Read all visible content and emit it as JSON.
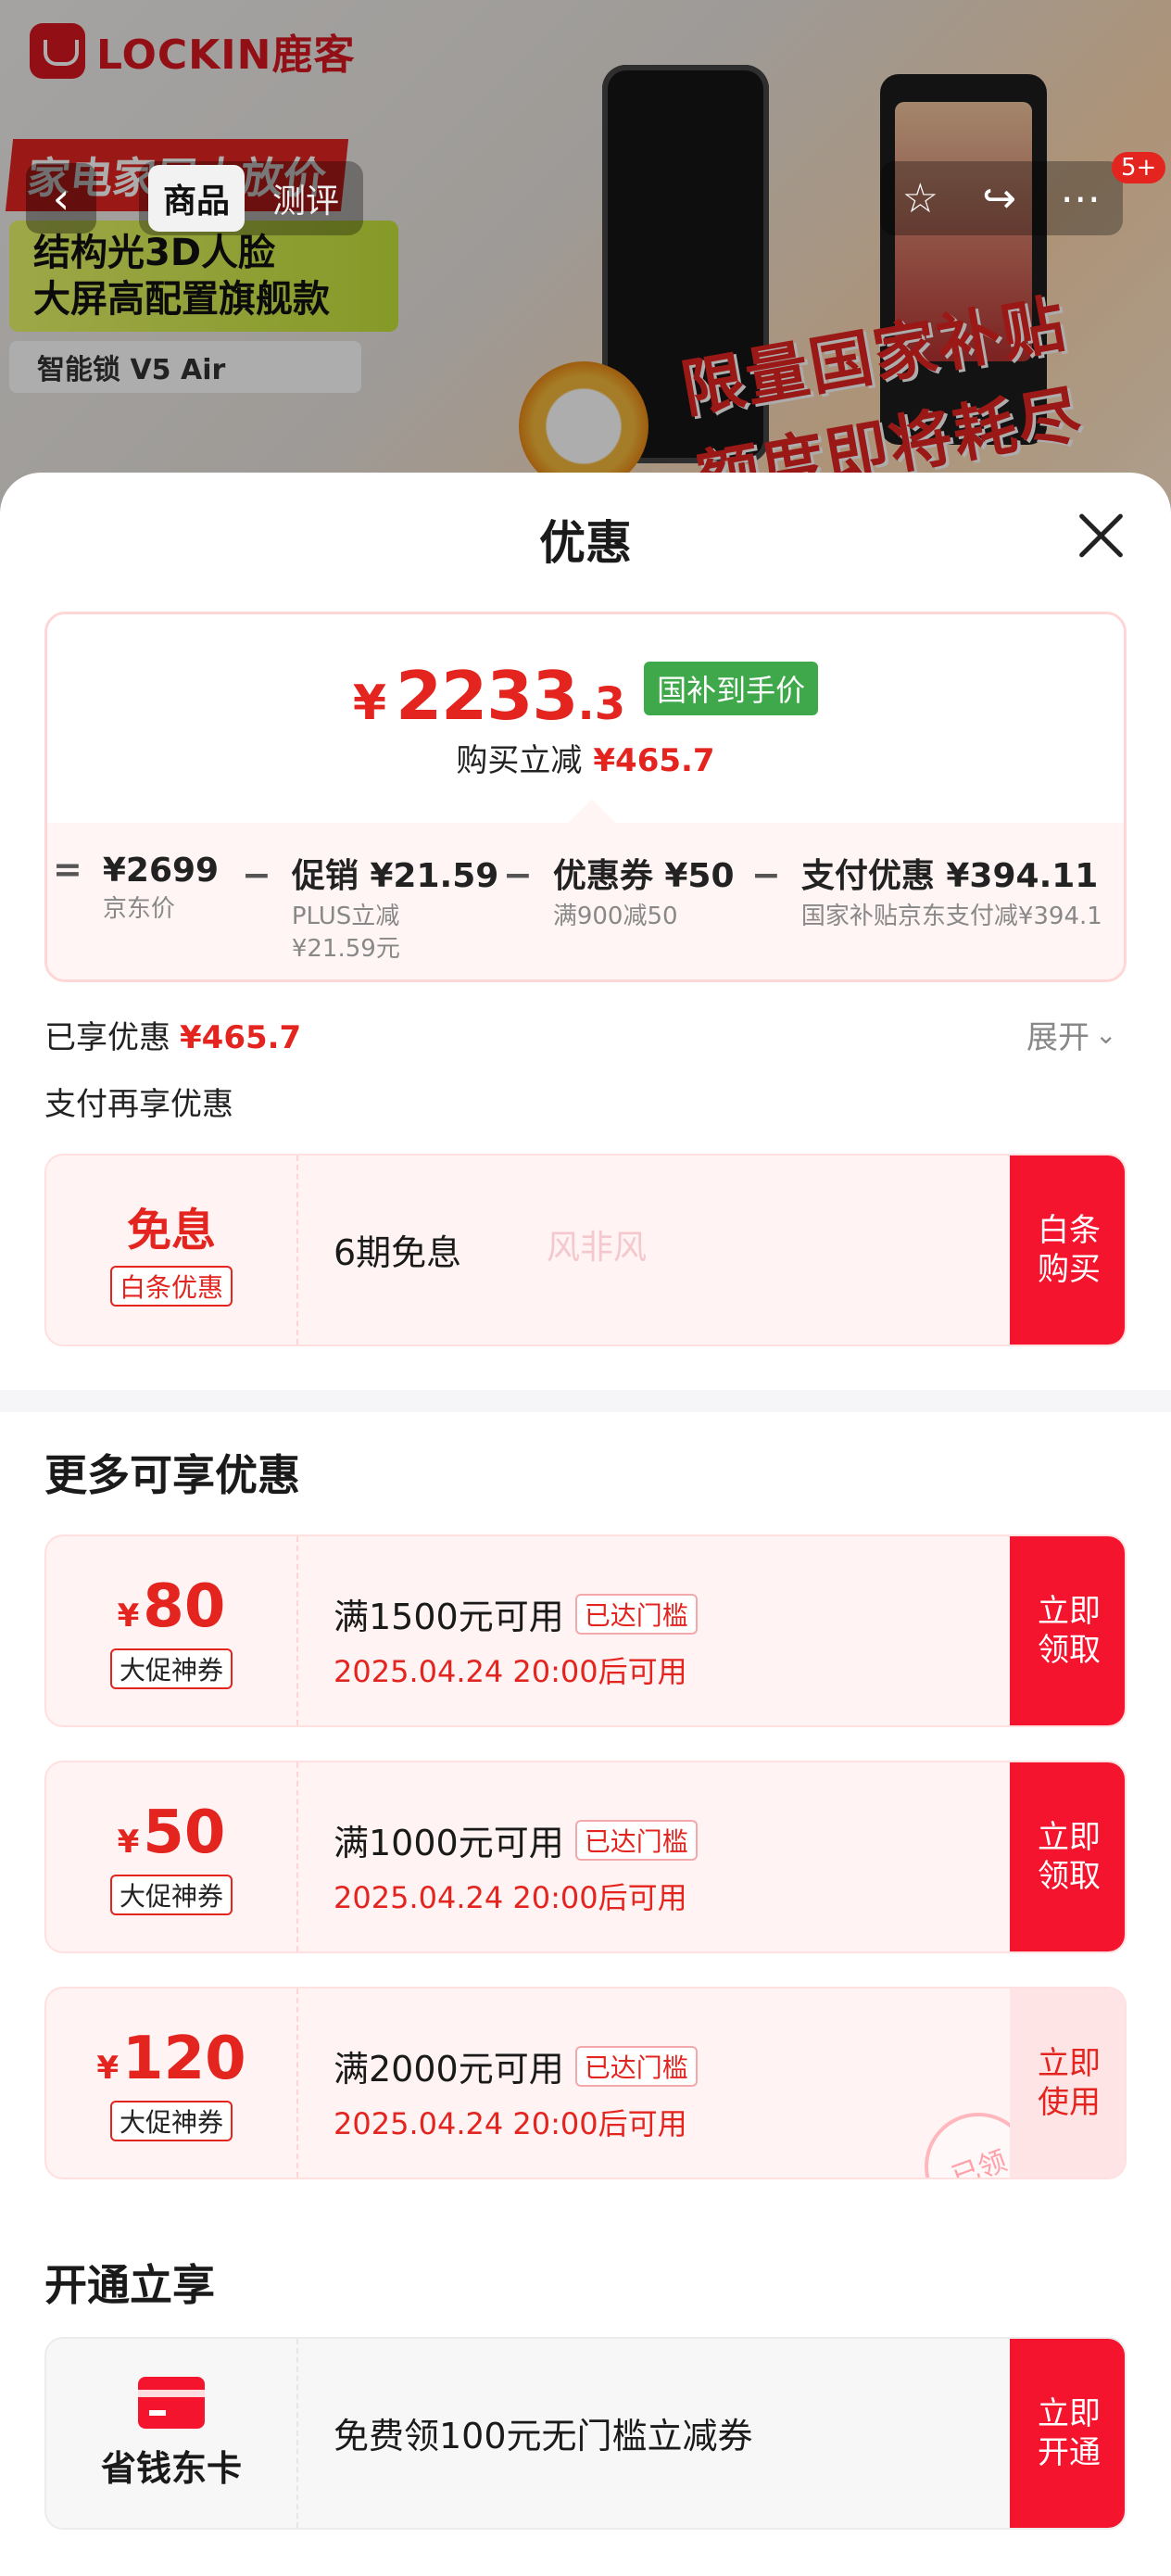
{
  "banner": {
    "brand": "LOCKIN鹿客",
    "promo_left": {
      "line1": "家电家居大放价",
      "line2a": "结构光3D人脸",
      "line2b": "大屏高配置旗舰款",
      "line3": "智能锁 V5 Air"
    },
    "promo_right": {
      "line1": "限量国家补贴",
      "line2": "额度即将耗尽"
    }
  },
  "nav": {
    "tabs": [
      {
        "label": "商品",
        "active": true
      },
      {
        "label": "测评",
        "active": false
      }
    ],
    "cart_badge": "5+"
  },
  "sheet": {
    "title": "优惠",
    "price": {
      "currency": "¥",
      "integer": "2233",
      "decimal": ".3",
      "tag": "国补到手价",
      "reduce_label": "购买立减",
      "reduce_amount": "¥465.7"
    },
    "breakdown": [
      {
        "op": "=",
        "value": "¥2699",
        "label": "京东价",
        "label2": ""
      },
      {
        "op": "−",
        "value": "促销 ¥21.59",
        "label": "PLUS立减",
        "label2": "¥21.59元"
      },
      {
        "op": "−",
        "value": "优惠券 ¥50",
        "label": "满900减50",
        "label2": ""
      },
      {
        "op": "−",
        "value": "支付优惠 ¥394.11",
        "label": "国家补贴京东支付减¥394.1",
        "label2": ""
      }
    ],
    "enjoyed_label": "已享优惠",
    "enjoyed_amount": "¥465.7",
    "expand_label": "展开",
    "pay_more_label": "支付再享优惠",
    "baitiao": {
      "big": "免息",
      "chip": "白条优惠",
      "text": "6期免息",
      "watermark": "风非风",
      "action": "白条购买"
    },
    "more_title": "更多可享优惠",
    "coupons": [
      {
        "yen": "¥",
        "amount": "80",
        "chip": "大促神券",
        "condition": "满1500元可用",
        "reached": "已达门槛",
        "time": "2025.04.24 20:00后可用",
        "action": "立即领取",
        "claimed": false
      },
      {
        "yen": "¥",
        "amount": "50",
        "chip": "大促神券",
        "condition": "满1000元可用",
        "reached": "已达门槛",
        "time": "2025.04.24 20:00后可用",
        "action": "立即领取",
        "claimed": false
      },
      {
        "yen": "¥",
        "amount": "120",
        "chip": "大促神券",
        "condition": "满2000元可用",
        "reached": "已达门槛",
        "time": "2025.04.24 20:00后可用",
        "action": "立即使用",
        "claimed": true,
        "stamp": "已领"
      }
    ],
    "open_title": "开通立享",
    "member_card": {
      "label": "省钱东卡",
      "text": "免费领100元无门槛立减券",
      "action": "立即开通"
    }
  }
}
